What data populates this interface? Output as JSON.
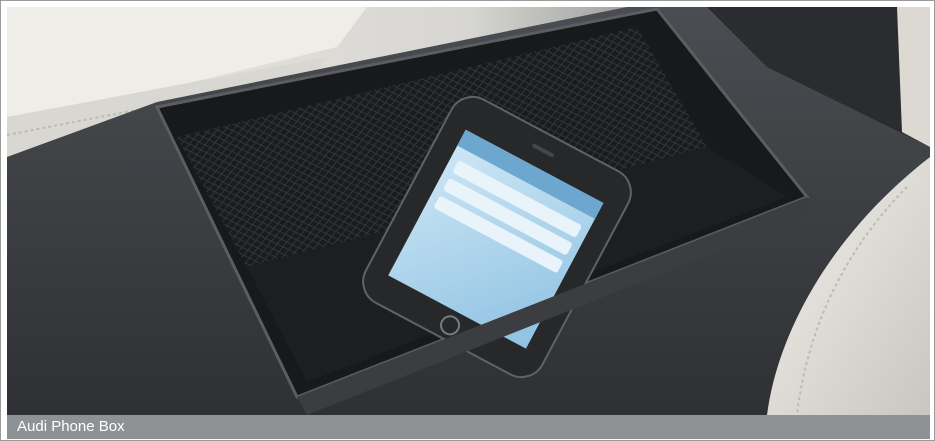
{
  "caption": {
    "text": "Audi Phone Box"
  },
  "colors": {
    "caption_bar": "#8f9294",
    "caption_text": "#ffffff",
    "console_dark": "#2b2d30",
    "seat_leather": "#e6e3dc",
    "phone_screen": "#a9d3ec"
  }
}
